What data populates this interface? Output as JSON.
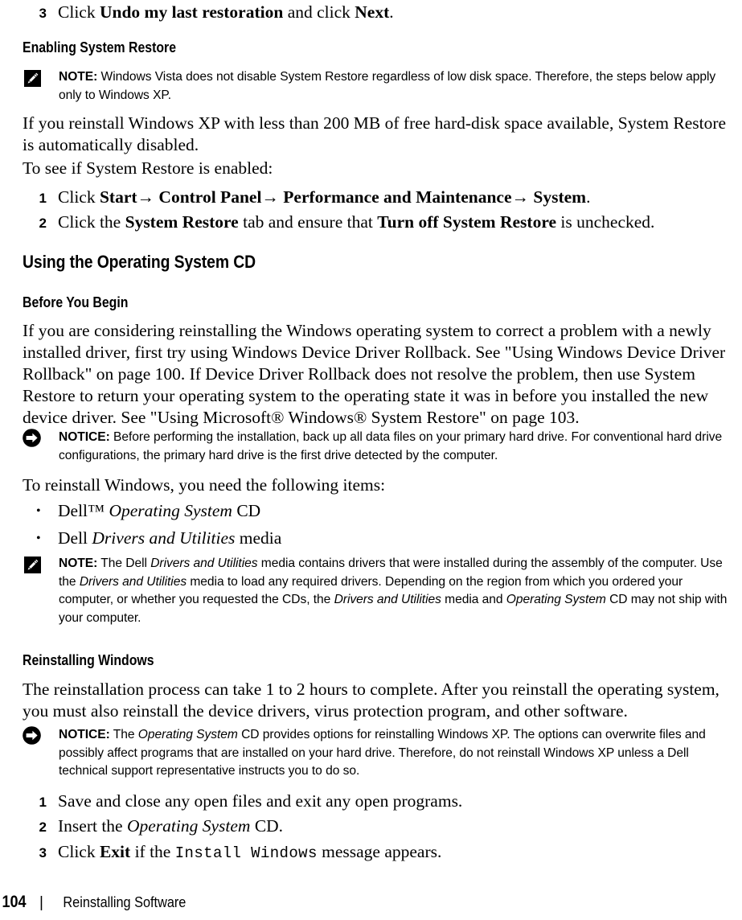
{
  "document": {
    "page_number": "104",
    "footer_title": "Reinstalling Software",
    "footer_separator": "|"
  },
  "content": {
    "step_undo": {
      "num": "3",
      "text_pre": "Click ",
      "bold1": "Undo my last restoration",
      "text_mid": " and click ",
      "bold2": "Next",
      "text_post": "."
    },
    "heading_enabling_system_restore": "Enabling System Restore",
    "note_vista": {
      "label": "NOTE:",
      "icon": "note-pencil-icon",
      "text": " Windows Vista does not disable System Restore regardless of low disk space. Therefore, the steps below apply only to Windows XP."
    },
    "para_reinstall_xp": "If you reinstall Windows XP with less than 200 MB of free hard-disk space available, System Restore is automatically disabled.",
    "para_to_see": "To see if System Restore is enabled:",
    "step_start": {
      "num": "1",
      "text_pre": "Click ",
      "bold_path": "Start→ Control Panel→ Performance and Maintenance→ System",
      "text_post": "."
    },
    "step_sr_tab": {
      "num": "2",
      "text_pre": "Click the ",
      "bold1": "System Restore",
      "text_mid": " tab and ensure that ",
      "bold2": "Turn off System Restore",
      "text_post": " is unchecked."
    },
    "heading_using_os_cd": "Using the Operating System CD",
    "heading_before_you_begin": "Before You Begin",
    "para_before_begin": {
      "t1": "If you are considering reinstalling the Windows operating system to correct a problem with a newly installed driver, first try using Windows Device Driver Rollback. See \"Using Windows Device Driver Rollback\" on page 100. If Device Driver Rollback does not resolve the problem, then use System Restore to return your operating system to the operating state it was in before you installed the new device driver. See \"Using Microsoft® Windows® System Restore\" on page 103."
    },
    "notice_backup": {
      "label": "NOTICE:",
      "icon": "notice-arrow-icon",
      "text": " Before performing the installation, back up all data files on your primary hard drive. For conventional hard drive configurations, the primary hard drive is the first drive detected by the computer."
    },
    "para_to_reinstall": "To reinstall Windows, you need the following items:",
    "bullet_os_cd": {
      "marker": "•",
      "pre": "Dell™ ",
      "italic": "Operating System",
      "post": " CD"
    },
    "bullet_drivers": {
      "marker": "•",
      "pre": "Dell ",
      "italic": "Drivers and Utilities",
      "post": " media"
    },
    "note_drivers": {
      "label": "NOTE:",
      "icon": "note-pencil-icon",
      "t1": " The Dell ",
      "i1": "Drivers and Utilities",
      "t2": " media contains drivers that were installed during the assembly of the computer. Use the ",
      "i2": "Drivers and Utilities",
      "t3": " media to load any required drivers. Depending on the region from which you ordered your computer, or whether you requested the CDs, the ",
      "i3": "Drivers and Utilities",
      "t4": " media and ",
      "i4": "Operating System",
      "t5": " CD may not ship with your computer."
    },
    "heading_reinstalling_windows": "Reinstalling Windows",
    "para_reinstall_process": "The reinstallation process can take 1 to 2 hours to complete. After you reinstall the operating system, you must also reinstall the device drivers, virus protection program, and other software.",
    "notice_os_cd": {
      "label": "NOTICE:",
      "icon": "notice-arrow-icon",
      "t1": " The ",
      "i1": "Operating System",
      "t2": " CD provides options for reinstalling Windows XP. The options can overwrite files and possibly affect programs that are installed on your hard drive. Therefore, do not reinstall Windows XP unless a Dell technical support representative instructs you to do so."
    },
    "step_save_close": {
      "num": "1",
      "text": "Save and close any open files and exit any open programs."
    },
    "step_insert_cd": {
      "num": "2",
      "pre": "Insert the ",
      "italic": "Operating System",
      "post": " CD."
    },
    "step_click_exit": {
      "num": "3",
      "pre": "Click ",
      "bold": "Exit",
      "mid": " if the ",
      "mono": "Install Windows",
      "post": " message appears."
    }
  }
}
